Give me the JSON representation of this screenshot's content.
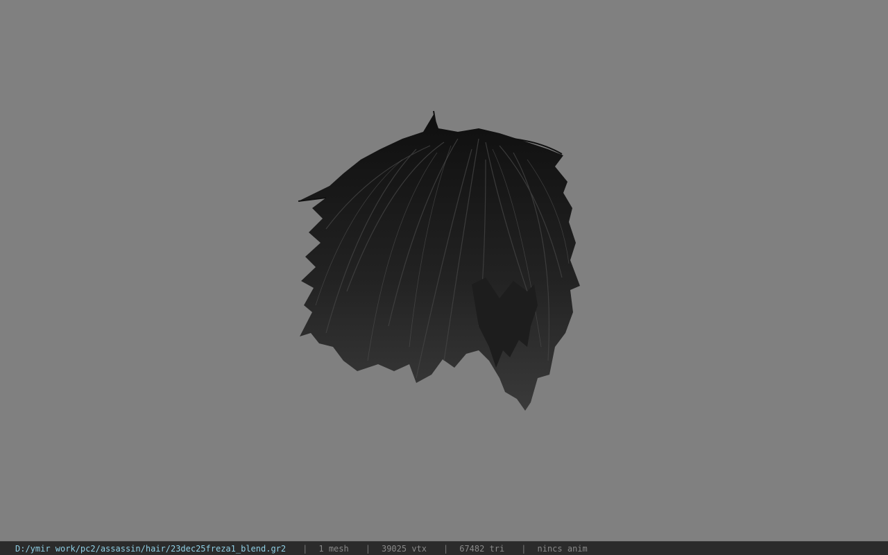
{
  "viewport": {
    "background_color": "#808080",
    "model": {
      "hair_color": "#1c1c1c",
      "skin_color": "#7a4a32"
    }
  },
  "statusbar": {
    "file_path": "D:/ymir work/pc2/assassin/hair/23dec25freza1_blend.gr2",
    "separator": "|",
    "mesh_count": "1 mesh",
    "vertex_count": "39025 vtx",
    "triangle_count": "67482 tri",
    "anim_label": "nincs anim",
    "path_color": "#8fd0e6",
    "text_color": "#8a8a8a"
  }
}
